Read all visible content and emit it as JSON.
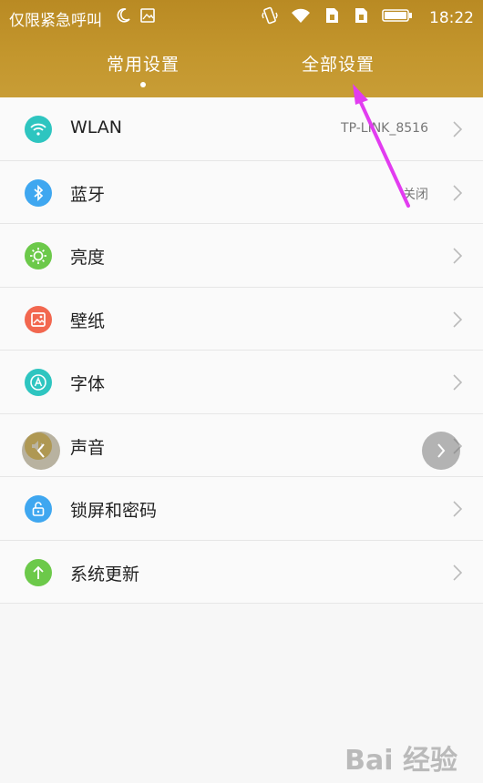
{
  "status_bar": {
    "carrier": "仅限紧急呼叫",
    "time": "18:22"
  },
  "tabs": [
    {
      "label": "常用设置",
      "active": true
    },
    {
      "label": "全部设置",
      "active": false
    }
  ],
  "settings": [
    {
      "label": "WLAN",
      "value": "TP-LINK_8516",
      "icon": "wifi-icon",
      "color": "#2ec5c0"
    },
    {
      "label": "蓝牙",
      "value": "关闭",
      "icon": "bluetooth-icon",
      "color": "#3fa7f0"
    },
    {
      "label": "亮度",
      "value": "",
      "icon": "brightness-icon",
      "color": "#6cc94a"
    },
    {
      "label": "壁纸",
      "value": "",
      "icon": "wallpaper-icon",
      "color": "#f2674f"
    },
    {
      "label": "字体",
      "value": "",
      "icon": "font-icon",
      "color": "#2ec5c0"
    },
    {
      "label": "声音",
      "value": "",
      "icon": "sound-icon",
      "color": "#e3b83a"
    },
    {
      "label": "锁屏和密码",
      "value": "",
      "icon": "lock-icon",
      "color": "#3fa7f0"
    },
    {
      "label": "系统更新",
      "value": "",
      "icon": "update-icon",
      "color": "#6cc94a"
    }
  ],
  "watermark": "Bai 经验"
}
